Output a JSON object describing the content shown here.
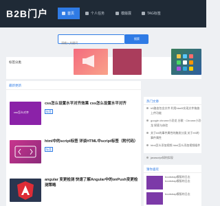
{
  "header": {
    "logo": "B2B门户",
    "nav": [
      {
        "label": "首页",
        "active": true
      },
      {
        "label": "个人任务",
        "active": false
      },
      {
        "label": "模版展",
        "active": false
      },
      {
        "label": "TAG标签",
        "active": false
      }
    ]
  },
  "search": {
    "placeholder": "请输入关键词",
    "button_label": "搜索"
  },
  "recommend": {
    "title": "标签分类"
  },
  "latest": {
    "title": "最新更新",
    "articles": [
      {
        "title": "css怎么设置水平对齐效果 css怎么设置水平对齐",
        "tag": "标签",
        "thumb_color": "#8b22a8",
        "thumb_text": "css怎么对齐"
      },
      {
        "title": "html中的script标签 详谈HTML中script标签（附代码）",
        "tag": "标签",
        "thumb_color": "#b0318e",
        "thumb_text": ""
      },
      {
        "title": "angular 变更检测 快速了解Angular中的onPush变更检测策略",
        "tag": "标签",
        "thumb_color": "#2a3650",
        "thumb_text": ""
      }
    ]
  },
  "hot": {
    "title": "热门文章",
    "items": [
      "h5路由包含文件 利用html5实现文件拖放上传功能",
      "google chrome小恐龙 谷歌 · Chrome小恐龙 探索与体验",
      "关于h5的事件属性的触发分类 关于H5的事件属性",
      "html怎么添加视频 html怎么添加视频插件",
      "javascript如何实现"
    ]
  },
  "tags": {
    "title": "猜你喜欢",
    "items": [
      "bootstrap模版的日志 bootstrap模版的日志",
      "bootstrap模版的日志"
    ]
  },
  "colors": {
    "header_bg": "#1f2a36",
    "accent": "#2f7be5"
  }
}
